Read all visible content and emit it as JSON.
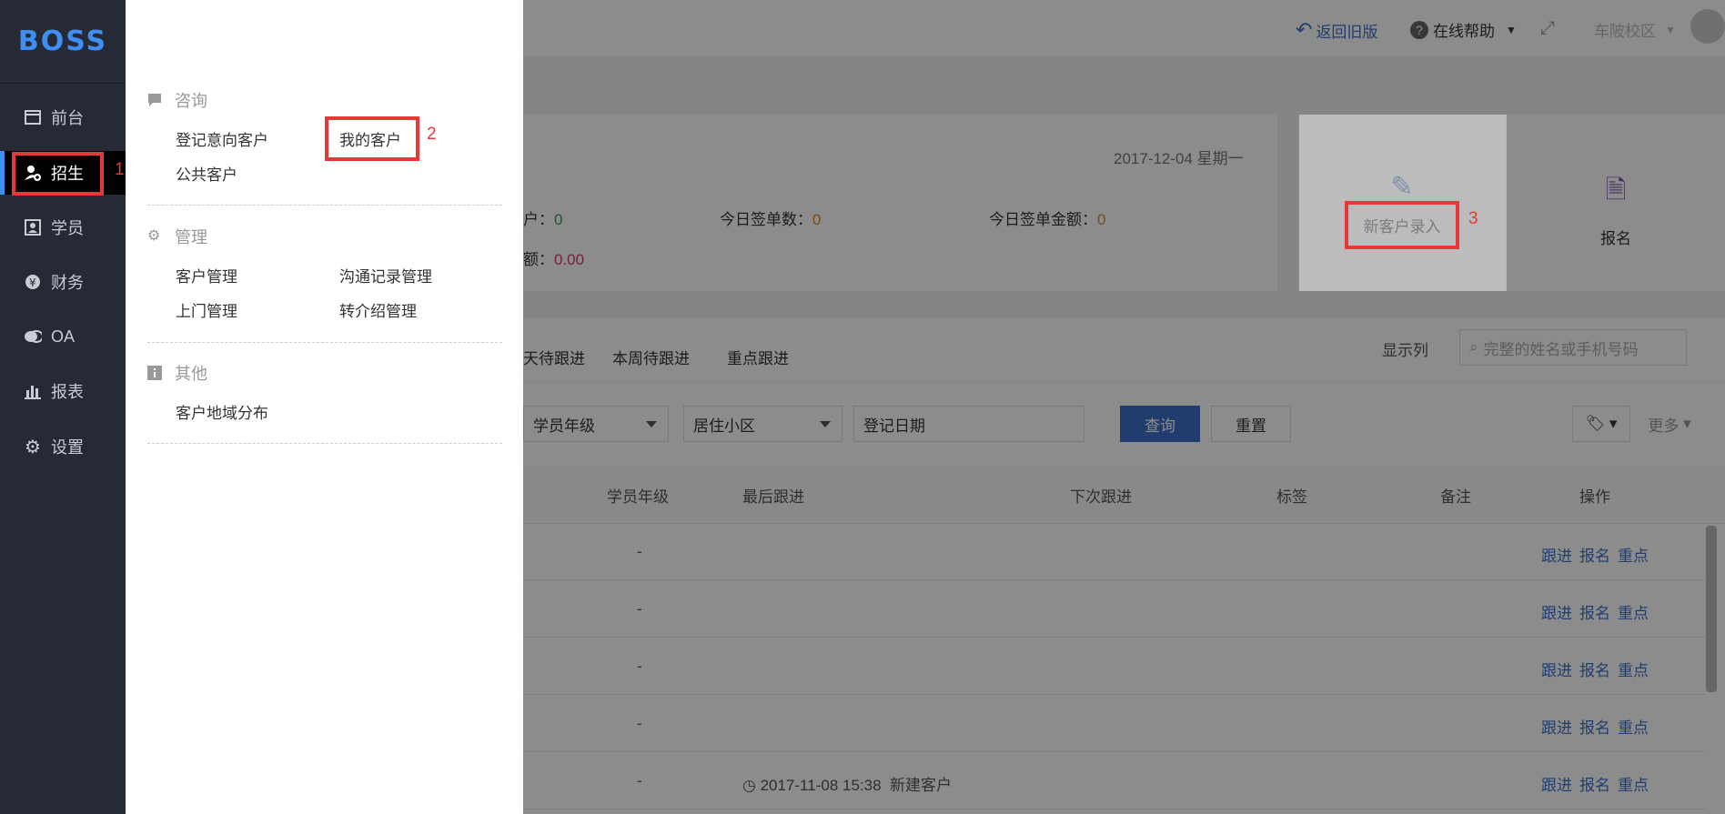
{
  "brand": {
    "logo_text": "BOSS",
    "accent": "#3f8ff2"
  },
  "sidenav": {
    "items": [
      {
        "label": "前台",
        "icon": "window-icon"
      },
      {
        "label": "招生",
        "icon": "user-add-icon"
      },
      {
        "label": "学员",
        "icon": "id-card-icon"
      },
      {
        "label": "财务",
        "icon": "yen-icon"
      },
      {
        "label": "OA",
        "icon": "chat-bubbles-icon"
      },
      {
        "label": "报表",
        "icon": "bar-chart-icon"
      },
      {
        "label": "设置",
        "icon": "gear-icon"
      }
    ],
    "active_index": 1
  },
  "annotations": {
    "n1": "1",
    "n2": "2",
    "n3": "3"
  },
  "menu": {
    "sections": [
      {
        "title": "咨询",
        "icon": "comment-icon",
        "links": [
          "登记意向客户",
          "我的客户",
          "公共客户"
        ]
      },
      {
        "title": "管理",
        "icon": "gear-icon",
        "links": [
          "客户管理",
          "沟通记录管理",
          "上门管理",
          "转介绍管理"
        ]
      },
      {
        "title": "其他",
        "icon": "info-box-icon",
        "links": [
          "客户地域分布"
        ]
      }
    ]
  },
  "topbar": {
    "back_label": "返回旧版",
    "help_label": "在线帮助",
    "campus_label": "车陂校区"
  },
  "summary": {
    "date": "2017-12-04 星期一",
    "stat1_label": "户：",
    "stat1_value": "0",
    "stat2_label": "今日签单数：",
    "stat2_value": "0",
    "stat3_label": "今日签单金额：",
    "stat3_value": "0",
    "stat4_label": "额：",
    "stat4_value": "0.00"
  },
  "quick": {
    "new_customer": "新客户录入",
    "enroll": "报名"
  },
  "tabs": [
    "天待跟进",
    "本周待跟进",
    "重点跟进"
  ],
  "toolbar": {
    "show_columns": "显示列",
    "search_placeholder": "完整的姓名或手机号码"
  },
  "filters": {
    "grade": "学员年级",
    "community": "居住小区",
    "date": "登记日期",
    "query": "查询",
    "reset": "重置",
    "more": "更多"
  },
  "table": {
    "headers": [
      "学员年级",
      "最后跟进",
      "下次跟进",
      "标签",
      "备注",
      "操作"
    ],
    "rows": [
      {
        "grade": "-",
        "last": "",
        "ops": [
          "跟进",
          "报名",
          "重点"
        ]
      },
      {
        "grade": "-",
        "last": "",
        "ops": [
          "跟进",
          "报名",
          "重点"
        ]
      },
      {
        "grade": "-",
        "last": "",
        "ops": [
          "跟进",
          "报名",
          "重点"
        ]
      },
      {
        "grade": "-",
        "last": "",
        "ops": [
          "跟进",
          "报名",
          "重点"
        ]
      },
      {
        "grade": "-",
        "last": "2017-11-08 15:38",
        "last_note": "新建客户",
        "ops": [
          "跟进",
          "报名",
          "重点"
        ]
      }
    ]
  }
}
